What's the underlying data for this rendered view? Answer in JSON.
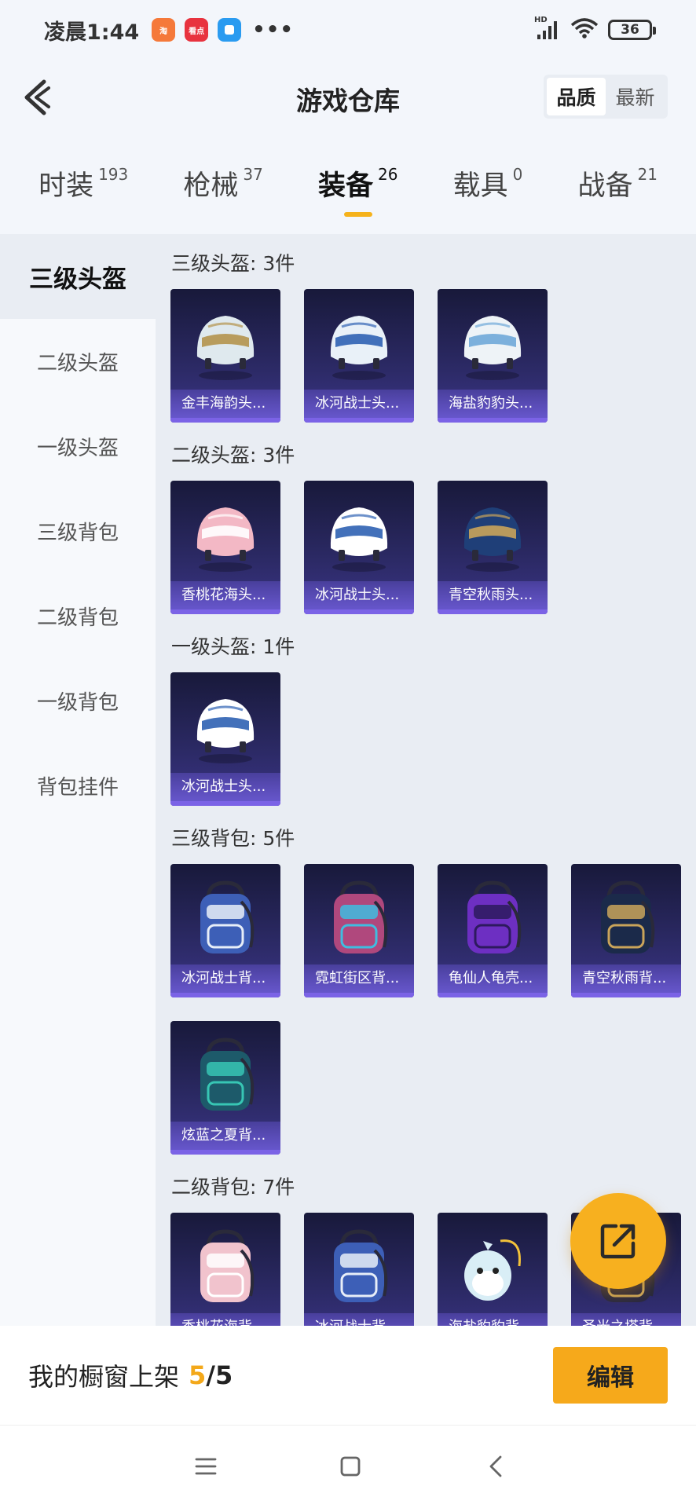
{
  "status_bar": {
    "time": "凌晨1:44",
    "apps": [
      {
        "icon": "taobao-app-icon",
        "text": "淘",
        "color": "#f5793a"
      },
      {
        "icon": "news-app-icon",
        "text": "看点",
        "color": "#e8333f"
      },
      {
        "icon": "app-icon-blue",
        "text": "",
        "color": "#2a9bf0"
      }
    ],
    "more": "•••",
    "network": "HD",
    "battery": "36"
  },
  "header": {
    "title": "游戏仓库",
    "sort_options": [
      "品质",
      "最新"
    ],
    "sort_active": "品质"
  },
  "tabs": [
    {
      "label": "时装",
      "count": "193"
    },
    {
      "label": "枪械",
      "count": "37"
    },
    {
      "label": "装备",
      "count": "26",
      "active": true
    },
    {
      "label": "载具",
      "count": "0"
    },
    {
      "label": "战备",
      "count": "21"
    }
  ],
  "sidebar": {
    "items": [
      "三级头盔",
      "二级头盔",
      "一级头盔",
      "三级背包",
      "二级背包",
      "一级背包",
      "背包挂件"
    ],
    "active": "三级头盔"
  },
  "sections": [
    {
      "title": "三级头盔: 3件",
      "items": [
        {
          "name": "金丰海韵头...",
          "art": "helmet",
          "main": "#dfe9ee",
          "accent": "#b4934c"
        },
        {
          "name": "冰河战士头...",
          "art": "helmet",
          "main": "#e9f1f8",
          "accent": "#2f62b3"
        },
        {
          "name": "海盐豹豹头...",
          "art": "helmet",
          "main": "#eef3f7",
          "accent": "#6fa8d8"
        }
      ]
    },
    {
      "title": "二级头盔: 3件",
      "items": [
        {
          "name": "香桃花海头...",
          "art": "helmet",
          "main": "#f3b8c5",
          "accent": "#ffffff"
        },
        {
          "name": "冰河战士头...",
          "art": "helmet",
          "main": "#ffffff",
          "accent": "#2f62b3"
        },
        {
          "name": "青空秋雨头...",
          "art": "helmet",
          "main": "#1f3f78",
          "accent": "#c9a45a"
        }
      ]
    },
    {
      "title": "一级头盔: 1件",
      "items": [
        {
          "name": "冰河战士头...",
          "art": "helmet",
          "main": "#ffffff",
          "accent": "#2f62b3"
        }
      ]
    },
    {
      "title": "三级背包: 5件",
      "items": [
        {
          "name": "冰河战士背...",
          "art": "backpack",
          "main": "#3d5fb7",
          "accent": "#e7eef8"
        },
        {
          "name": "霓虹街区背...",
          "art": "backpack",
          "main": "#b0487d",
          "accent": "#3fbde0"
        },
        {
          "name": "龟仙人龟壳...",
          "art": "backpack",
          "main": "#6d2fc2",
          "accent": "#2d1a5e"
        },
        {
          "name": "青空秋雨背...",
          "art": "backpack",
          "main": "#1b2a4a",
          "accent": "#c9a45a"
        },
        {
          "name": "炫蓝之夏背...",
          "art": "backpack",
          "main": "#1d5a6a",
          "accent": "#37c6b4"
        }
      ]
    },
    {
      "title": "二级背包: 7件",
      "items": [
        {
          "name": "香桃花海背...",
          "art": "backpack",
          "main": "#f1c3cd",
          "accent": "#ffffff"
        },
        {
          "name": "冰河战士背...",
          "art": "backpack",
          "main": "#3d5fb7",
          "accent": "#e7eef8"
        },
        {
          "name": "海盐豹豹背...",
          "art": "plush",
          "main": "#d9eef6",
          "accent": "#f3c23a"
        },
        {
          "name": "圣光之塔背...",
          "art": "backpack",
          "main": "#2c2a40",
          "accent": "#c9a45a"
        }
      ]
    }
  ],
  "showcase": {
    "label": "我的橱窗上架",
    "current": "5",
    "separator": "/",
    "total": "5",
    "edit_label": "编辑"
  },
  "colors": {
    "accent": "#f6a91b",
    "card_bg": "#2c2a66",
    "rarity_purple": "#7b63e6"
  }
}
